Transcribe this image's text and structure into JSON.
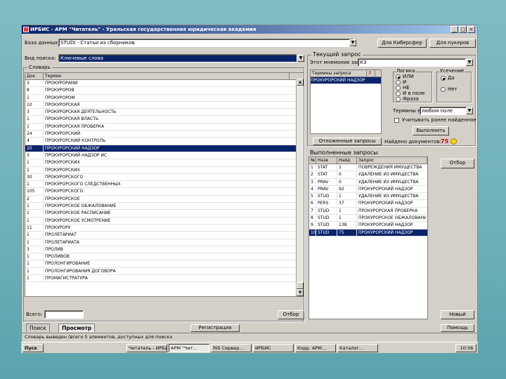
{
  "window": {
    "title": "ИРБИС - АРМ \"Читатель\" - Уральская государственная юридическая академия",
    "buttons": [
      "_",
      "□",
      "×"
    ]
  },
  "database": {
    "label": "База данных:",
    "value": "STUDI - Статьи из сборников"
  },
  "top_buttons": {
    "about": "Для Киберсфер",
    "hints": "Для пукеров"
  },
  "search_mode": {
    "label": "Вид поиска:",
    "value": "Ключевые слова"
  },
  "dictionary": {
    "title": "Словарь",
    "columns": [
      "Док",
      "Термин"
    ],
    "rows": [
      {
        "n": "3",
        "t": "ПРОКУРОРАМИ"
      },
      {
        "n": "8",
        "t": "ПРОКУРОРОВ"
      },
      {
        "n": "1",
        "t": "ПРОКУРОРОМ"
      },
      {
        "n": "10",
        "t": "ПРОКУРОРСКАЯ"
      },
      {
        "n": "3",
        "t": "ПРОКУРОРСКАЯ ДЕЯТЕЛЬНОСТЬ"
      },
      {
        "n": "1",
        "t": "ПРОКУРОРСКАЯ ВЛАСТЬ"
      },
      {
        "n": "1",
        "t": "ПРОКУРОРСКАЯ ПРОВЕРКА"
      },
      {
        "n": "24",
        "t": "ПРОКУРОРСКИЙ"
      },
      {
        "n": "4",
        "t": "ПРОКУРОРСКИЙ КОНТРОЛЬ"
      },
      {
        "n": "20",
        "t": "ПРОКУРОРСКИЙ НАДЗОР",
        "sel": true
      },
      {
        "n": "3",
        "t": "ПРОКУРОРСКИЙ НАДЗОР ИС"
      },
      {
        "n": "1",
        "t": "ПРОКУРОРСКИХ"
      },
      {
        "n": "1",
        "t": "ПРОКУРОРСКИХ"
      },
      {
        "n": "30",
        "t": "ПРОКУРОРСКОГО"
      },
      {
        "n": "1",
        "t": "ПРОКУРОРСКОГО СЛЕДСТВЕННЫХ"
      },
      {
        "n": "105",
        "t": "ПРОКУРОРСКОГО"
      },
      {
        "n": "2",
        "t": "ПРОКУРОРСКОЕ"
      },
      {
        "n": "1",
        "t": "ПРОКУРОРСКОЕ ОБЖАЛОВАНИЕ"
      },
      {
        "n": "1",
        "t": "ПРОКУРОРСКОЕ РАСПИСАНИЕ"
      },
      {
        "n": "1",
        "t": "ПРОКУРОРСКОЕ УСМОТРЕНИЕ"
      },
      {
        "n": "11",
        "t": "ПРОКУРОРУ"
      },
      {
        "n": "1",
        "t": "ПРОЛЕТАРИАТ"
      },
      {
        "n": "1",
        "t": "ПРОЛЕТАРИАТА"
      },
      {
        "n": "3",
        "t": "ПРОЛИВ"
      },
      {
        "n": "1",
        "t": "ПРОЛИВОВ"
      },
      {
        "n": "1",
        "t": "ПРОЛОНГИРОВАНИЕ"
      },
      {
        "n": "1",
        "t": "ПРОЛОНГИРОВАНИЯ ДОГОВОРА"
      },
      {
        "n": "1",
        "t": "ПРОМАГИСТРАТУРА"
      }
    ],
    "count_label": "Всего:",
    "select_button": "Отбор"
  },
  "current_query": {
    "title": "Текущий запрос",
    "stage_label": "Этот мнемоник запроса:",
    "stage_value": "КЗ",
    "terms_columns": [
      "Термины запроса",
      "Л"
    ],
    "terms": [
      "ПРОКУРОРСКИЙ НАДЗОР"
    ],
    "logic_title": "Логика",
    "logic_options": [
      "ИЛИ",
      "И",
      "НЕ",
      "И в поле",
      "Фраза"
    ],
    "logic_selected": 0,
    "truncation_title": "Усечение",
    "truncation_options": [
      "Да",
      "Нет"
    ],
    "truncation_selected": 0,
    "term_label": "Термины в:",
    "term_value": "любом поле",
    "check_label": "Учитывать ранее найденное",
    "execute_button": "Выполнить",
    "found_label": "Найдено документов:",
    "found_value": "75",
    "prev_queries_button": "Отложенные запросы"
  },
  "executed_queries": {
    "title": "Выполненные запросы",
    "columns": [
      "№",
      "Назв",
      "Найд",
      "Запрос"
    ],
    "rows": [
      {
        "n": "1",
        "a": "STAT",
        "b": "1",
        "c": "ПОВРЕЖДЕНИЯ ИМУЩЕСТВА"
      },
      {
        "n": "2",
        "a": "STAT",
        "b": "0",
        "c": "УДАЛЕНИЕ ИЗ ИМУЩЕСТВА"
      },
      {
        "n": "3",
        "a": "PRAV",
        "b": "0",
        "c": "УДАЛЕНИЕ ИЗ ИМУЩЕСТВА"
      },
      {
        "n": "4",
        "a": "PRAV",
        "b": "92",
        "c": "ПРОКУРОРСКИЙ НАДЗОР"
      },
      {
        "n": "5",
        "a": "STUD",
        "b": "1",
        "c": "УДАЛЕНИЕ ИЗ ИМУЩЕСТВА"
      },
      {
        "n": "6",
        "a": "PERS",
        "b": "37",
        "c": "ПРОКУРОРСКИЙ НАДЗОР"
      },
      {
        "n": "7",
        "a": "STUD",
        "b": "1",
        "c": "ПРОКУРОРСКАЯ ПРОВЕРКА"
      },
      {
        "n": "8",
        "a": "STUD",
        "b": "1",
        "c": "ПРОКУРОРСКОЕ ОБЖАЛОВАНИЕ"
      },
      {
        "n": "9",
        "a": "STUD",
        "b": "138",
        "c": "ПРОКУРОРСКИЙ НАДЗОР"
      },
      {
        "n": "10",
        "a": "STUD",
        "b": "75",
        "c": "ПРОКУРОРСКИЙ НАДЗОР",
        "sel": true
      }
    ],
    "ok_button": "Отбор",
    "new_button": "Новый",
    "help_button": "Помощь"
  },
  "tabs": [
    "Поиск",
    "Просмотр"
  ],
  "bottom_button": "Регистрация",
  "status_text": "Словарь выведен (всего 5 элементов, доступных для поиска",
  "taskbar": {
    "start": "Пуск",
    "tasks": [
      "Читатель - ИРБИС",
      "АРМ \"Чит...",
      "RIS Сервер...",
      "ИРБИС",
      "Корр. АРМ...",
      "Каталог..."
    ],
    "clock": "10:06"
  }
}
